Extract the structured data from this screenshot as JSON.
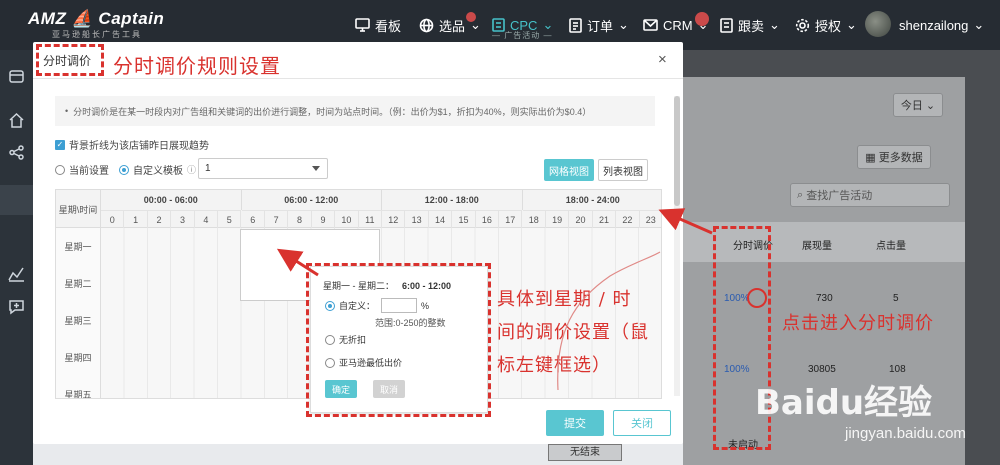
{
  "brand": {
    "logo": "AMZ Captain",
    "tagline": "亚马逊船长广告工具"
  },
  "nav": [
    {
      "label": "看板",
      "icon": "monitor-icon"
    },
    {
      "label": "选品",
      "icon": "globe-icon"
    },
    {
      "label": "CPC",
      "icon": "cpc-icon",
      "sub": "— 广告活动 —"
    },
    {
      "label": "订单",
      "icon": "document-icon"
    },
    {
      "label": "CRM",
      "icon": "mail-icon"
    },
    {
      "label": "跟卖",
      "icon": "follow-icon"
    },
    {
      "label": "授权",
      "icon": "gear-icon"
    }
  ],
  "user": {
    "name": "shenzailong"
  },
  "background": {
    "date_select": "今日",
    "more_data": "更多数据",
    "search_placeholder": "查找广告活动",
    "col_dayparting": "分时调价",
    "col_impressions": "展现量",
    "col_clicks": "点击量",
    "rows": [
      {
        "pct": "100%",
        "impressions": "730",
        "clicks": "5"
      },
      {
        "pct": "100%",
        "impressions": "30805",
        "clicks": "108"
      }
    ],
    "status_inactive": "未启动",
    "no_end": "无结束"
  },
  "modal": {
    "title": "分时调价",
    "info": "分时调价是在某一时段内对广告组和关键词的出价进行调整，时间为站点时间。（例：出价为$1，折扣为40%，则实际出价为$0.4）",
    "trend_checkbox": "背景折线为该店铺昨日展现趋势",
    "radio_current": "当前设置",
    "radio_custom": "自定义模板",
    "template_value": "1",
    "btn_grid_view": "网格视图",
    "btn_list_view": "列表视图",
    "grid_corner": "星期\\时间",
    "ranges": [
      "00:00 - 06:00",
      "06:00 - 12:00",
      "12:00 - 18:00",
      "18:00 - 24:00"
    ],
    "hours": [
      "0",
      "1",
      "2",
      "3",
      "4",
      "5",
      "6",
      "7",
      "8",
      "9",
      "10",
      "11",
      "12",
      "13",
      "14",
      "15",
      "16",
      "17",
      "18",
      "19",
      "20",
      "21",
      "22",
      "23"
    ],
    "days": [
      "星期一",
      "星期二",
      "星期三",
      "星期四",
      "星期五"
    ],
    "btn_submit": "提交",
    "btn_close": "关闭"
  },
  "popup": {
    "range_days": "星期一 - 星期二：",
    "range_time": "6:00 - 12:00",
    "opt_custom": "自定义：",
    "percent": "%",
    "range_hint": "范围:0-250的整数",
    "opt_no_discount": "无折扣",
    "opt_amazon_min": "亚马逊最低出价",
    "btn_ok": "确定",
    "btn_cancel": "取消"
  },
  "annotations": {
    "title": "分时调价规则设置",
    "detail": [
      "具体到星期 / 时",
      "间的调价设置（鼠",
      "标左键框选）"
    ],
    "click": "点击进入分时调价",
    "accent": "#d9322e"
  },
  "watermark": {
    "text": "Baidu经验",
    "url": "jingyan.baidu.com"
  }
}
